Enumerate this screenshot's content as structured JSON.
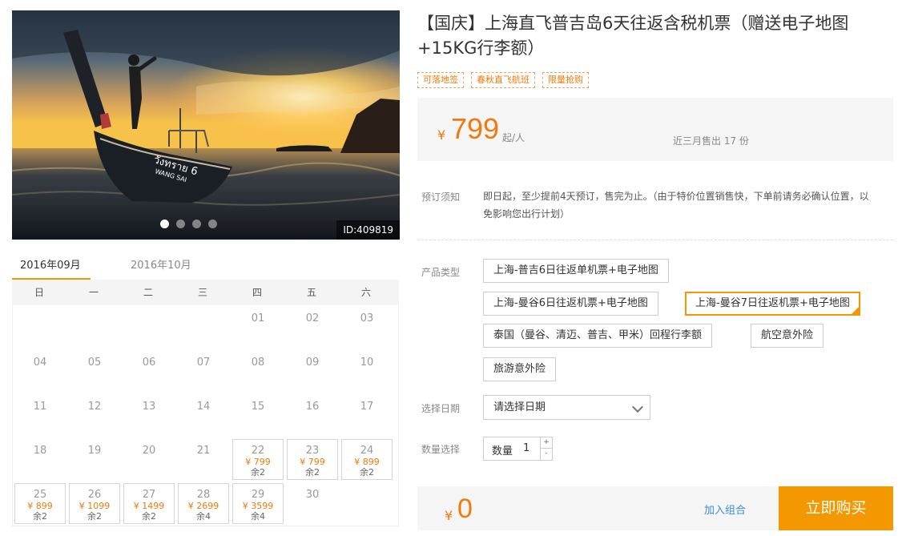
{
  "hero": {
    "photo_id": "ID:409819",
    "slides": [
      true,
      false,
      false,
      false
    ],
    "boat_lettering": [
      "วังทราย 6",
      "WANG SAI"
    ]
  },
  "calendar": {
    "tabs": [
      "2016年09月",
      "2016年10月"
    ],
    "weekdays": [
      "日",
      "一",
      "二",
      "三",
      "四",
      "五",
      "六"
    ],
    "lead_blanks": 4,
    "days": [
      {
        "d": "01"
      },
      {
        "d": "02"
      },
      {
        "d": "03"
      },
      {
        "d": "04"
      },
      {
        "d": "05"
      },
      {
        "d": "06"
      },
      {
        "d": "07"
      },
      {
        "d": "08"
      },
      {
        "d": "09"
      },
      {
        "d": "10"
      },
      {
        "d": "11"
      },
      {
        "d": "12"
      },
      {
        "d": "13"
      },
      {
        "d": "14"
      },
      {
        "d": "15"
      },
      {
        "d": "16"
      },
      {
        "d": "17"
      },
      {
        "d": "18"
      },
      {
        "d": "19"
      },
      {
        "d": "20"
      },
      {
        "d": "21"
      },
      {
        "d": "22",
        "price": "¥ 799",
        "remain": "余2"
      },
      {
        "d": "23",
        "price": "¥ 799",
        "remain": "余2"
      },
      {
        "d": "24",
        "price": "¥ 899",
        "remain": "余2"
      },
      {
        "d": "25",
        "price": "¥ 899",
        "remain": "余2"
      },
      {
        "d": "26",
        "price": "¥ 1099",
        "remain": "余2"
      },
      {
        "d": "27",
        "price": "¥ 1499",
        "remain": "余2"
      },
      {
        "d": "28",
        "price": "¥ 2699",
        "remain": "余4"
      },
      {
        "d": "29",
        "price": "¥ 3599",
        "remain": "余4"
      },
      {
        "d": "30"
      }
    ]
  },
  "product": {
    "title": "【国庆】上海直飞普吉岛6天往返含税机票（赠送电子地图+15KG行李额）",
    "tags": [
      "可落地签",
      "春秋直飞航班",
      "限量抢购"
    ],
    "price_symbol": "¥",
    "price": "799",
    "price_unit": "起/人",
    "sold": "近三月售出 17 份"
  },
  "notice": {
    "label": "预订须知",
    "text": "即日起，至少提前4天预订，售完为止。（由于特价位置销售快，下单前请务必确认位置，以免影响您出行计划）"
  },
  "options": {
    "label": "产品类型",
    "items": [
      "上海-普吉6日往返单机票+电子地图",
      "上海-曼谷6日往返机票+电子地图",
      "上海-曼谷7日往返机票+电子地图",
      "泰国（曼谷、清迈、普吉、甲米）回程行李额",
      "航空意外险",
      "旅游意外险"
    ],
    "selected_index": 2
  },
  "date_select": {
    "label": "选择日期",
    "placeholder": "请选择日期"
  },
  "quantity": {
    "label": "数量选择",
    "field_label": "数量",
    "value": "1",
    "up": "+",
    "down": "-"
  },
  "purchase": {
    "total_symbol": "¥",
    "total": "0",
    "combo_label": "加入组合",
    "buy_label": "立即购买"
  },
  "colors": {
    "accent": "#f39800",
    "price": "#f07a0c",
    "link": "#3c8fd5"
  }
}
